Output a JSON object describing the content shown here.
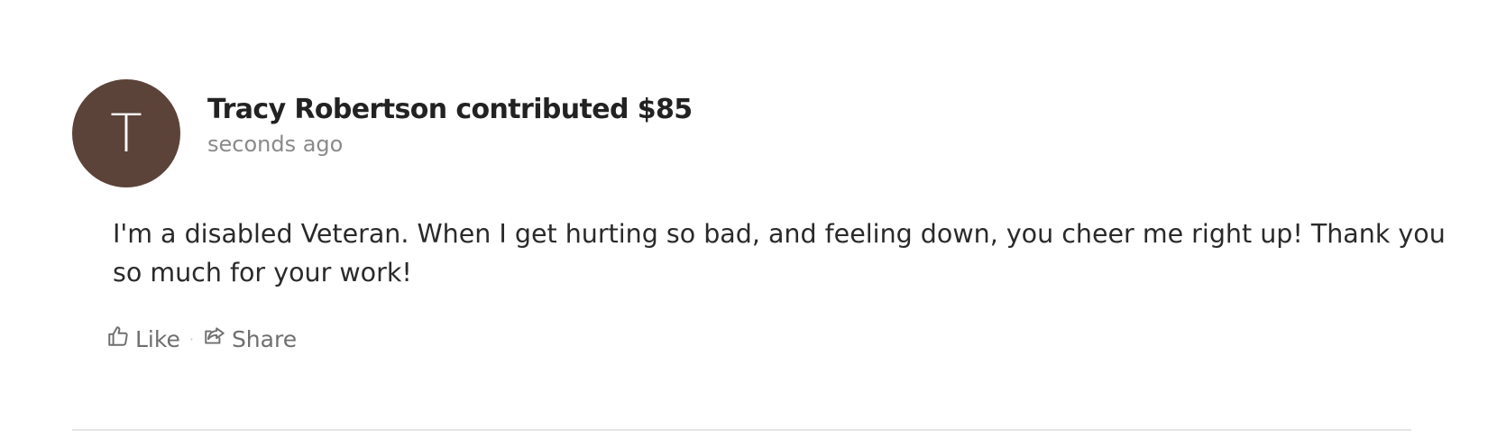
{
  "contribution": {
    "avatar_initial": "T",
    "headline": "Tracy Robertson contributed $85",
    "timestamp": "seconds ago",
    "message": "I'm a disabled Veteran. When I get hurting so bad, and feeling down, you cheer me right up! Thank you so much for your work!",
    "actions": {
      "like_label": "Like",
      "separator": "·",
      "share_label": "Share"
    }
  },
  "colors": {
    "avatar_bg": "#5c4339",
    "muted_text": "#8a8a8a",
    "divider": "#e4e4e4"
  },
  "icons": {
    "like": "thumbs-up-icon",
    "share": "share-icon"
  }
}
